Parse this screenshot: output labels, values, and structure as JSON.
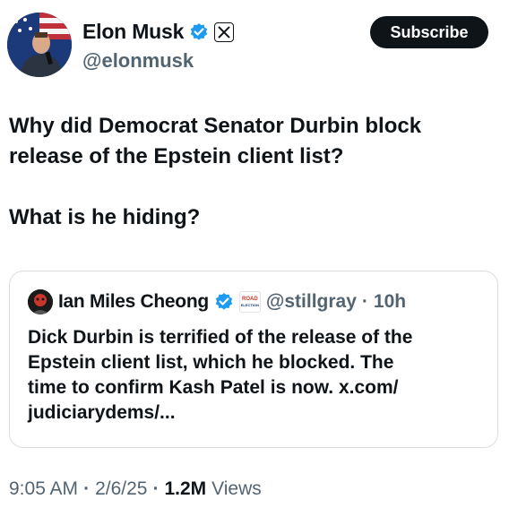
{
  "author": {
    "name": "Elon Musk",
    "handle": "@elonmusk"
  },
  "subscribe_label": "Subscribe",
  "tweet": {
    "text": "Why did Democrat Senator Durbin block\nrelease of the Epstein client list?\n\nWhat is he hiding?"
  },
  "quote": {
    "name": "Ian Miles Cheong",
    "handle": "@stillgray",
    "separator": "·",
    "time": "10h",
    "badge_text_top": "ROAD",
    "badge_text_bottom": "ELECTION",
    "text": "Dick Durbin is terrified of the release of the\nEpstein client list, which he blocked. The\ntime to confirm Kash Patel is now. x.com/\njudiciarydems/..."
  },
  "meta": {
    "time": "9:05 AM",
    "dot1": "·",
    "date": "2/6/25",
    "dot2": "·",
    "views_count": "1.2M",
    "views_label": "Views"
  },
  "colors": {
    "verified_blue": "#1d9bf0",
    "secondary_text": "#536471",
    "primary_text": "#0f1419"
  },
  "icons": [
    "verified-badge-icon",
    "x-logo-icon",
    "road-election-badge-icon"
  ]
}
